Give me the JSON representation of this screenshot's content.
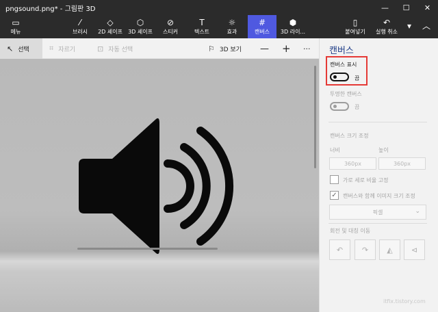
{
  "window": {
    "title": "pngsound.png* - 그림판 3D",
    "controls": {
      "minimize": "—",
      "maximize": "☐",
      "close": "✕"
    }
  },
  "ribbon": {
    "menu": "메뉴",
    "brushes": "브러시",
    "shapes2d": "2D 셰이프",
    "shapes3d": "3D 셰이프",
    "stickers": "스티커",
    "text": "텍스트",
    "effects": "효과",
    "canvas": "캔버스",
    "library3d": "3D 라이...",
    "paste": "붙여넣기",
    "undo": "실행 취소",
    "active_color": "#4f59e0"
  },
  "toolbar": {
    "select": "선택",
    "crop": "자르기",
    "magic_select": "자동 선택",
    "view3d": "3D 보기"
  },
  "panel": {
    "title": "캔버스",
    "show_canvas_label": "캔버스 표시",
    "show_canvas_state": "끔",
    "transparent_label": "투명한 캔버스",
    "transparent_state": "끔",
    "resize_label": "캔버스 크기 조정",
    "width_label": "너비",
    "height_label": "높이",
    "width_value": "360px",
    "height_value": "360px",
    "lock_ratio_label": "가로 세로 비율 고정",
    "resize_image_label": "캔버스와 함께 이미지 크기 조정",
    "unit_value": "픽셀",
    "rotate_label": "회전 및 대칭 이동"
  },
  "watermark": "itfix.tistory.com"
}
